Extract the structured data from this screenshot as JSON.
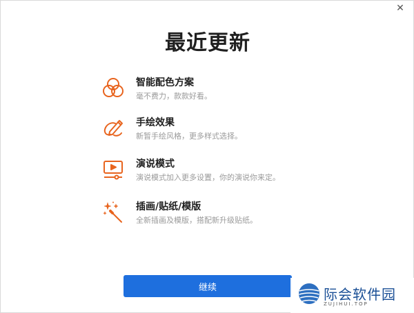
{
  "window": {
    "close_glyph": "✕"
  },
  "title": "最近更新",
  "accent_color": "#e8641e",
  "features": [
    {
      "icon": "color-circles-icon",
      "name": "智能配色方案",
      "desc": "毫不费力，款款好看。"
    },
    {
      "icon": "pen-brush-icon",
      "name": "手绘效果",
      "desc": "新暂手绘风格，更多样式选择。"
    },
    {
      "icon": "presentation-play-icon",
      "name": "演说模式",
      "desc": "演说模式加入更多设置，你的演说你来定。"
    },
    {
      "icon": "magic-wand-icon",
      "name": "插画/贴纸/模版",
      "desc": "全新插画及模版，搭配新升级贴纸。"
    }
  ],
  "continue_button": {
    "label": "继续",
    "color": "#1e6fde"
  },
  "watermark": {
    "name": "际会软件园",
    "sub": "ZUJIHUI.TOP"
  }
}
